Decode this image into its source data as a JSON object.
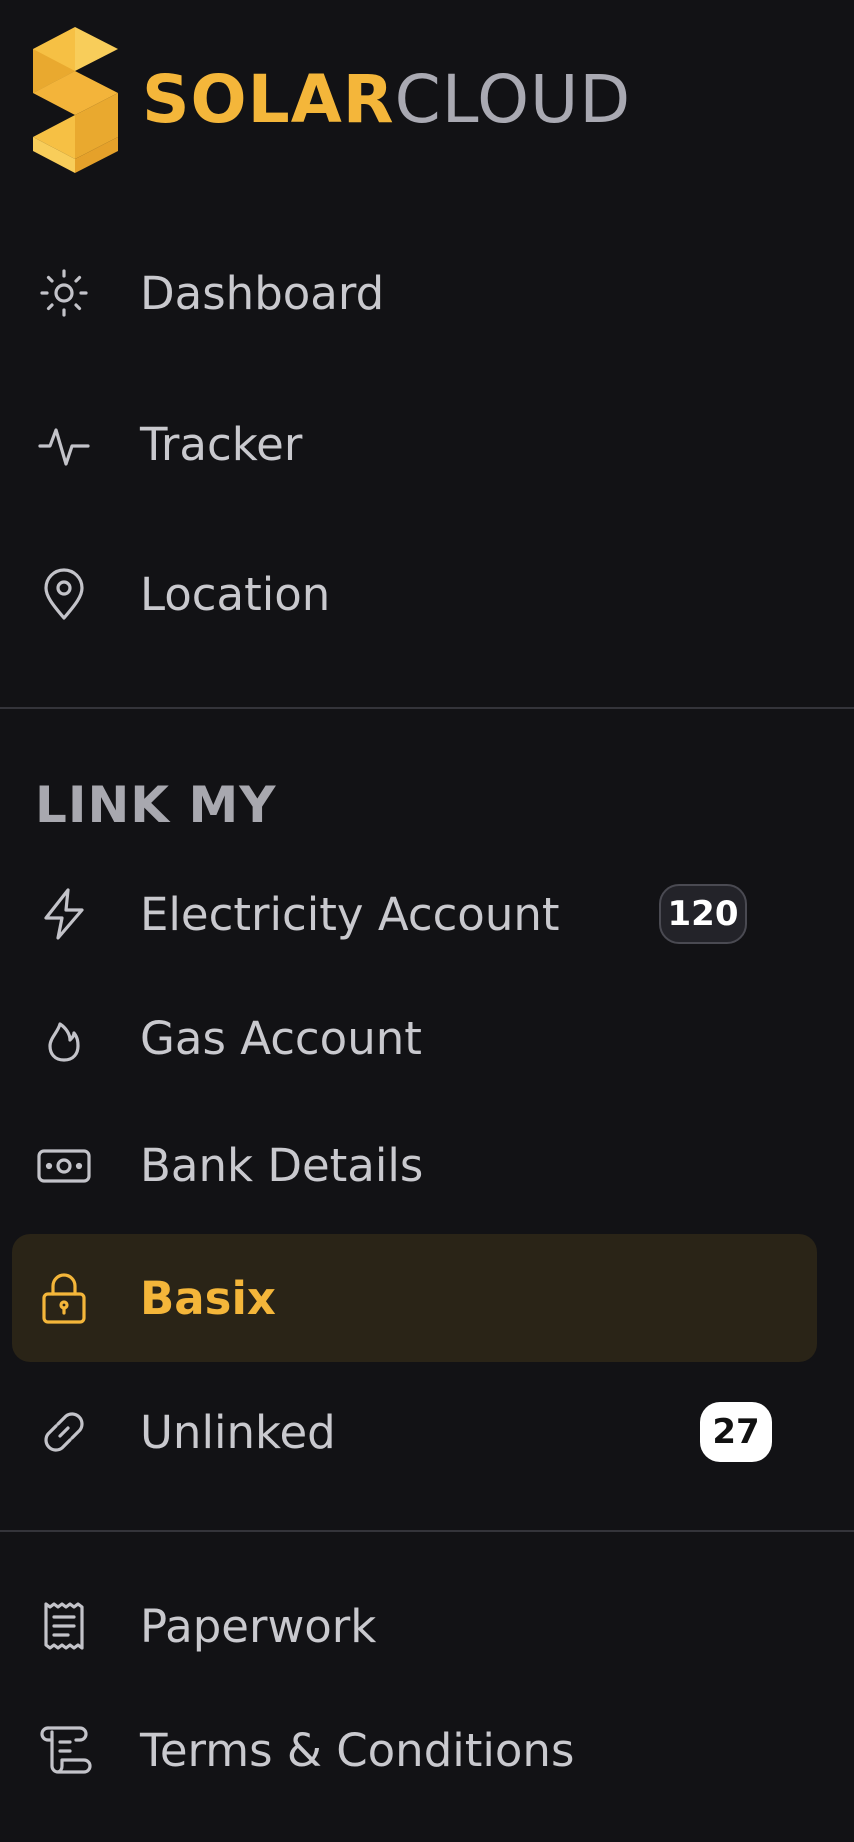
{
  "brand": {
    "solar": "SOLAR",
    "cloud": "CLOUD"
  },
  "nav_main": [
    {
      "label": "Dashboard",
      "icon": "sun-icon"
    },
    {
      "label": "Tracker",
      "icon": "activity-icon"
    },
    {
      "label": "Location",
      "icon": "map-pin-icon"
    }
  ],
  "link_section": {
    "title": "LINK MY",
    "items": [
      {
        "label": "Electricity Account",
        "icon": "bolt-icon",
        "badge": "120"
      },
      {
        "label": "Gas Account",
        "icon": "flame-icon"
      },
      {
        "label": "Bank Details",
        "icon": "cash-icon"
      },
      {
        "label": "Basix",
        "icon": "lock-icon",
        "active": true
      },
      {
        "label": "Unlinked",
        "icon": "link-icon",
        "badge": "27"
      }
    ]
  },
  "nav_bottom": [
    {
      "label": "Paperwork",
      "icon": "receipt-icon"
    },
    {
      "label": "Terms & Conditions",
      "icon": "scroll-icon"
    }
  ],
  "colors": {
    "accent": "#f4b63a",
    "background": "#121215",
    "active_background": "#2a2417"
  }
}
